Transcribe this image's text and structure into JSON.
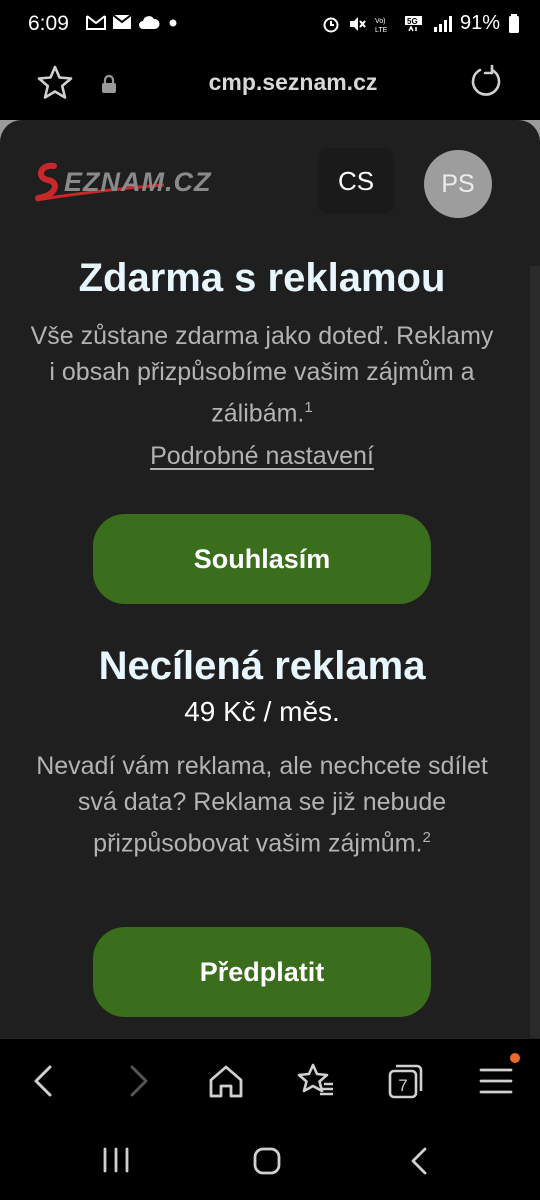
{
  "status_bar": {
    "time": "6:09",
    "battery": "91%",
    "icons": [
      "gmail-icon",
      "mail-icon",
      "cloud-icon",
      "dot-icon",
      "alarm-icon",
      "mute-icon",
      "volte-icon",
      "5g-icon",
      "signal-icon",
      "battery-icon"
    ]
  },
  "browser": {
    "url": "cmp.seznam.cz"
  },
  "header": {
    "logo_text": "SEZNAM.CZ",
    "language": "CS",
    "avatar_initials": "PS"
  },
  "option_free": {
    "title": "Zdarma s reklamou",
    "description": "Vše zůstane zdarma jako doteď. Reklamy i obsah přizpůsobíme vašim zájmům a zálibám.",
    "footnote": "1",
    "details_link": "Podrobné nastavení",
    "button": "Souhlasím"
  },
  "option_paid": {
    "title": "Necílená reklama",
    "price": "49 Kč / měs.",
    "description": "Nevadí vám reklama, ale nechcete sdílet svá data? Reklama se již nebude přizpůsobovat vašim zájmům.",
    "footnote": "2",
    "button": "Předplatit"
  },
  "toolbar": {
    "tab_count": "7",
    "notification_color": "#e96a2a"
  },
  "colors": {
    "accent_button": "#3a6d1c",
    "heading": "#e8f6ff",
    "logo_red": "#c8282a"
  }
}
